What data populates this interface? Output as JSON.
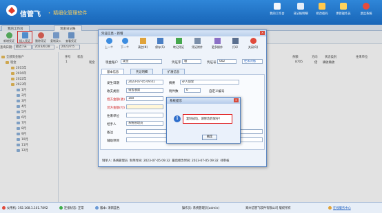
{
  "app": {
    "brand": "信管飞",
    "subtitle": "・ 精细化管理软件"
  },
  "topbar": {
    "items": [
      {
        "label": "我的工作台",
        "color": "#f3f6fb"
      },
      {
        "label": "日记账明细",
        "color": "#e6eef8"
      },
      {
        "label": "修改密码",
        "color": "#ffc94d"
      },
      {
        "label": "更新操作员",
        "color": "#ffd35c"
      },
      {
        "label": "退出系统",
        "color": "#e64b3c"
      }
    ]
  },
  "tabs": [
    "我的工作台",
    "现金日记账"
  ],
  "toolbar": {
    "items": [
      "新增凭证",
      "插入凭证",
      "删除凭证",
      "复制录入",
      "查看凭证"
    ],
    "highlight_index": 1
  },
  "query": {
    "label": "查询日期:",
    "mode": "最近7天",
    "from": "2023/6/28",
    "sep": "~",
    "to": "2023/7/5"
  },
  "tree": {
    "root": "全部资金账户",
    "account": "现金",
    "years": [
      "2015年",
      "2016年",
      "2022年",
      "2023年"
    ],
    "months": [
      "1月",
      "2月",
      "3月",
      "4月",
      "5月",
      "6月",
      "7月",
      "8月",
      "9月",
      "10月",
      "11月",
      "12月"
    ]
  },
  "grid": {
    "headers": [
      "序号",
      "状态",
      "余额",
      "方向",
      "状态类别",
      "往来单位"
    ],
    "row": {
      "index": "1",
      "account": "现金",
      "balance": "8705",
      "direction": "借",
      "status": "确收确收"
    }
  },
  "dialog": {
    "title": "凭证信息 - 新增",
    "toolbar": [
      "上一个",
      "下一个",
      "清空(N)",
      "保存(S)",
      "转记凭证",
      "凭证附件",
      "更多操作",
      "打印",
      "关闭(Q)"
    ],
    "account_label": "现金账户",
    "account_value": "现金",
    "voucher_word_label": "凭证字",
    "voucher_word_value": "收",
    "voucher_no_label": "凭证号",
    "voucher_no_value": "002",
    "link_label": "往来对账",
    "tabs": [
      "基本信息",
      "凭证明细",
      "扩展信息"
    ],
    "fields": {
      "date_label": "发生日期",
      "date_value": "2023-07-05 09:41",
      "summary_label": "摘要",
      "summary_value": "存入现金",
      "settle_label": "收支类别",
      "settle_value": "销售收款",
      "attach_label": "附件数",
      "attach_value": "0",
      "custom_label": "自定义编号",
      "amount_label": "借方金额(收)",
      "amount_value": "100",
      "credit_label": "贷方金额(付)",
      "unit_label": "往来单位",
      "handler_label": "经手人",
      "handler_value": "系统管理员",
      "note_label": "备注",
      "aux_label": "辅助项目",
      "aux_right": "关联凭证科目"
    },
    "footer": {
      "maker_label": "制单人:",
      "maker": "系统管理员",
      "make_time_label": "制单时间:",
      "make_time": "2023-07-05 09:32",
      "modify_time_label": "最后修改时间:",
      "modify_time": "2023-07-05 09:32",
      "audit": "待审核"
    }
  },
  "message": {
    "title": "系统提示",
    "text": "复制成功，请修改后保存！",
    "ok": "确定"
  },
  "status": {
    "ip": "仪用机: 192.168.1.101.7892",
    "conn": "连接状态: 正常",
    "theme": "版本: 清新蓝色",
    "operator": "操作员: 系统管理员(admin)",
    "company": "郑州信管飞软件有限公司 版权所有",
    "service": "在线服务中心"
  }
}
